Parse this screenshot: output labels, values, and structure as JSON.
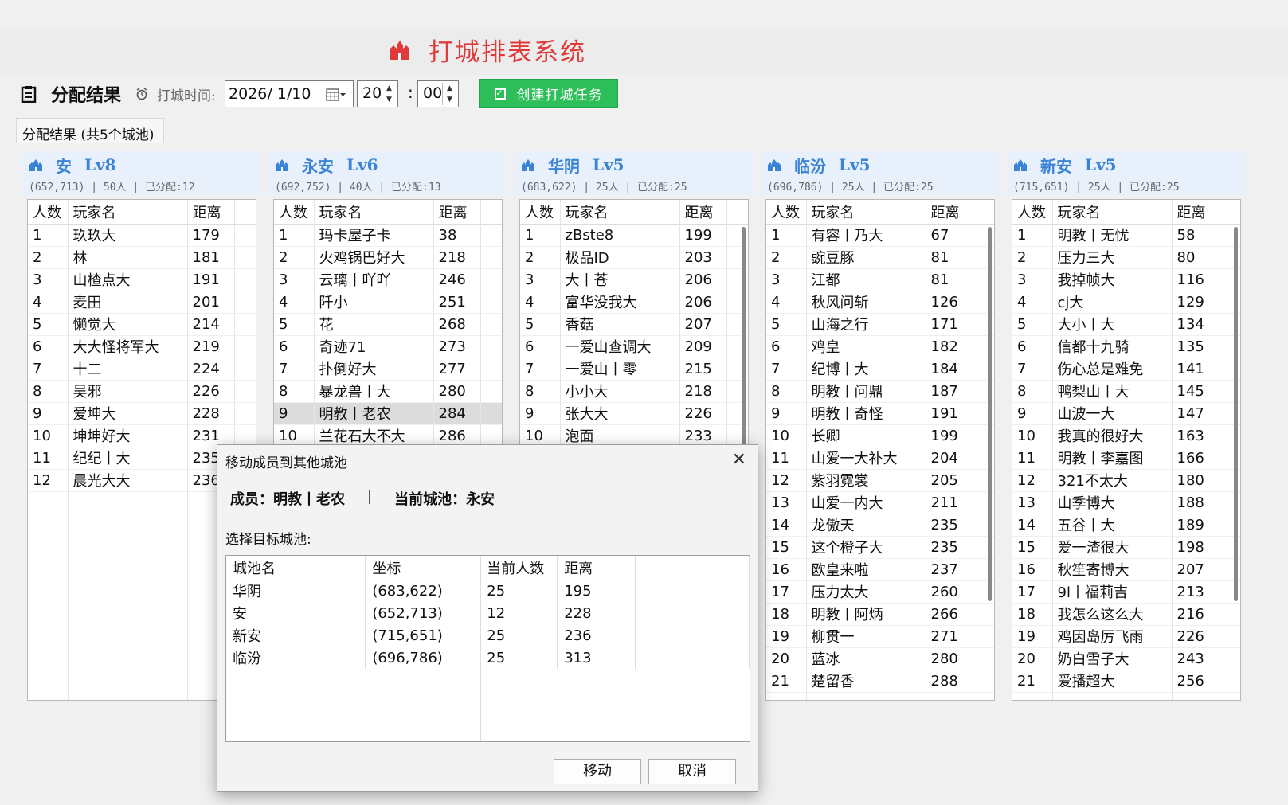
{
  "app": {
    "title": "打城排表系统"
  },
  "toolbar": {
    "section_label": "分配结果",
    "time_label": "打城时间:",
    "date_value": "2026/  1/10",
    "hour_value": "20",
    "minute_value": "00",
    "create_label": "创建打城任务"
  },
  "tab": {
    "label": "分配结果 (共5个城池)"
  },
  "columns": {
    "count": "人数",
    "name": "玩家名",
    "distance": "距离"
  },
  "panels": [
    {
      "title": "安",
      "level": "Lv8",
      "sub": "(652,713) | 50人 | 已分配:12",
      "rows": [
        [
          "1",
          "玖玖大",
          "179"
        ],
        [
          "2",
          "林",
          "181"
        ],
        [
          "3",
          "山楂点大",
          "191"
        ],
        [
          "4",
          "麦田",
          "201"
        ],
        [
          "5",
          "懒觉大",
          "214"
        ],
        [
          "6",
          "大大怪将军大",
          "219"
        ],
        [
          "7",
          "十二",
          "224"
        ],
        [
          "8",
          "吴邪",
          "226"
        ],
        [
          "9",
          "爱坤大",
          "228"
        ],
        [
          "10",
          "坤坤好大",
          "231"
        ],
        [
          "11",
          "纪纪丨大",
          "235"
        ],
        [
          "12",
          "晨光大大",
          "236"
        ]
      ]
    },
    {
      "title": "永安",
      "level": "Lv6",
      "sub": "(692,752) | 40人 | 已分配:13",
      "rows": [
        [
          "1",
          "玛卡屋子卡",
          "38"
        ],
        [
          "2",
          "火鸡锅巴好大",
          "218"
        ],
        [
          "3",
          "云璃丨吖吖",
          "246"
        ],
        [
          "4",
          "阡小",
          "251"
        ],
        [
          "5",
          "花",
          "268"
        ],
        [
          "6",
          "奇迹71",
          "273"
        ],
        [
          "7",
          "扑倒好大",
          "277"
        ],
        [
          "8",
          "暴龙兽丨大",
          "280"
        ],
        [
          "9",
          "明教丨老农",
          "284"
        ],
        [
          "10",
          "兰花石大不大",
          "286"
        ]
      ]
    },
    {
      "title": "华阴",
      "level": "Lv5",
      "sub": "(683,622) | 25人 | 已分配:25",
      "rows": [
        [
          "1",
          "zBste8",
          "199"
        ],
        [
          "2",
          "极品ID",
          "203"
        ],
        [
          "3",
          "大丨苍",
          "206"
        ],
        [
          "4",
          "富华没我大",
          "206"
        ],
        [
          "5",
          "香菇",
          "207"
        ],
        [
          "6",
          "一爱山查调大",
          "209"
        ],
        [
          "7",
          "一爱山丨零",
          "215"
        ],
        [
          "8",
          "小小大",
          "218"
        ],
        [
          "9",
          "张大大",
          "226"
        ],
        [
          "10",
          "泡面",
          "233"
        ]
      ]
    },
    {
      "title": "临汾",
      "level": "Lv5",
      "sub": "(696,786) | 25人 | 已分配:25",
      "rows": [
        [
          "1",
          "有容丨乃大",
          "67"
        ],
        [
          "2",
          "豌豆豚",
          "81"
        ],
        [
          "3",
          "江都",
          "81"
        ],
        [
          "4",
          "秋风问斩",
          "126"
        ],
        [
          "5",
          "山海之行",
          "171"
        ],
        [
          "6",
          "鸡皇",
          "182"
        ],
        [
          "7",
          "纪博丨大",
          "184"
        ],
        [
          "8",
          "明教丨问鼎",
          "187"
        ],
        [
          "9",
          "明教丨奇怪",
          "191"
        ],
        [
          "10",
          "长卿",
          "199"
        ],
        [
          "11",
          "山爱一大补大",
          "204"
        ],
        [
          "12",
          "紫羽霓裳",
          "205"
        ],
        [
          "13",
          "山爱一内大",
          "211"
        ],
        [
          "14",
          "龙傲天",
          "235"
        ],
        [
          "15",
          "这个橙子大",
          "235"
        ],
        [
          "16",
          "欧皇来啦",
          "237"
        ],
        [
          "17",
          "压力太大",
          "260"
        ],
        [
          "18",
          "明教丨阿炳",
          "266"
        ],
        [
          "19",
          "柳贯一",
          "271"
        ],
        [
          "20",
          "蓝冰",
          "280"
        ],
        [
          "21",
          "楚留香",
          "288"
        ]
      ]
    },
    {
      "title": "新安",
      "level": "Lv5",
      "sub": "(715,651) | 25人 | 已分配:25",
      "rows": [
        [
          "1",
          "明教丨无忧",
          "58"
        ],
        [
          "2",
          "压力三大",
          "80"
        ],
        [
          "3",
          "我掉帧大",
          "116"
        ],
        [
          "4",
          "cj大",
          "129"
        ],
        [
          "5",
          "大小丨大",
          "134"
        ],
        [
          "6",
          "信都十九骑",
          "135"
        ],
        [
          "7",
          "伤心总是难免",
          "141"
        ],
        [
          "8",
          "鸭梨山丨大",
          "145"
        ],
        [
          "9",
          "山波一大",
          "147"
        ],
        [
          "10",
          "我真的很好大",
          "163"
        ],
        [
          "11",
          "明教丨李嘉图",
          "166"
        ],
        [
          "12",
          "321不太大",
          "180"
        ],
        [
          "13",
          "山季博大",
          "188"
        ],
        [
          "14",
          "五谷丨大",
          "189"
        ],
        [
          "15",
          "爱一渣很大",
          "198"
        ],
        [
          "16",
          "秋笙寄博大",
          "207"
        ],
        [
          "17",
          "9l丨福莉吉",
          "213"
        ],
        [
          "18",
          "我怎么这么大",
          "216"
        ],
        [
          "19",
          "鸡因岛厉飞雨",
          "226"
        ],
        [
          "20",
          "奶白雪子大",
          "243"
        ],
        [
          "21",
          "爱播超大",
          "256"
        ]
      ]
    }
  ],
  "dialog": {
    "title": "移动成员到其他城池",
    "member_label": "成员：明教丨老农",
    "separator": "|",
    "current_label": "当前城池：永安",
    "select_label": "选择目标城池:",
    "columns": [
      "城池名",
      "坐标",
      "当前人数",
      "距离"
    ],
    "rows": [
      [
        "华阴",
        "(683,622)",
        "25",
        "195"
      ],
      [
        "安",
        "(652,713)",
        "12",
        "228"
      ],
      [
        "新安",
        "(715,651)",
        "25",
        "236"
      ],
      [
        "临汾",
        "(696,786)",
        "25",
        "313"
      ]
    ],
    "move_label": "移动",
    "cancel_label": "取消"
  }
}
